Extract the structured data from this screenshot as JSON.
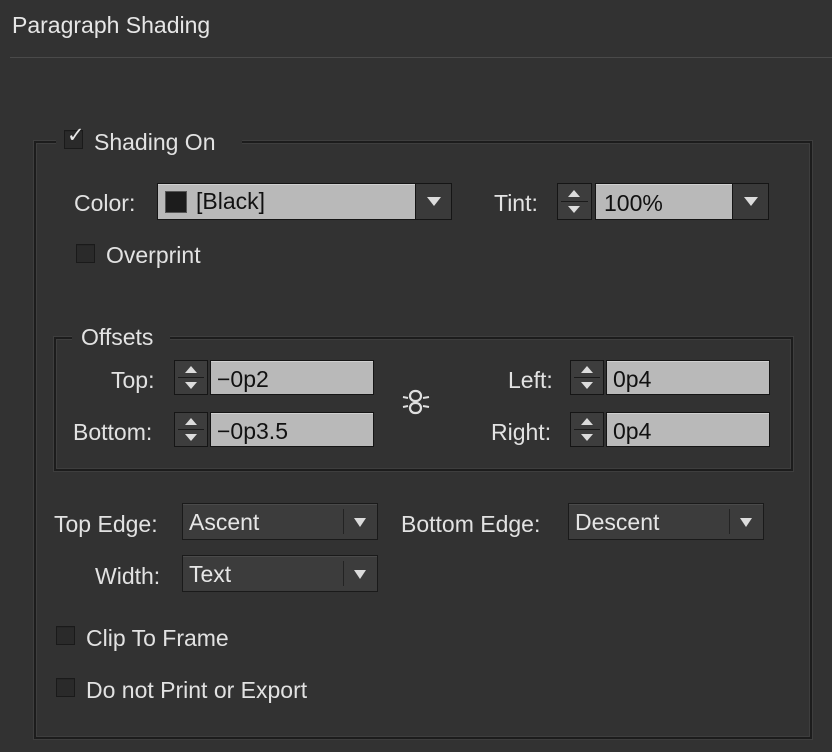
{
  "panel": {
    "title": "Paragraph Shading"
  },
  "shading": {
    "label": "Shading On",
    "checked": true,
    "color_label": "Color:",
    "color_value": "[Black]",
    "swatch_color": "#1c1c1c",
    "tint_label": "Tint:",
    "tint_value": "100%",
    "overprint_label": "Overprint",
    "overprint_checked": false
  },
  "offsets": {
    "legend": "Offsets",
    "top_label": "Top:",
    "top_value": "−0p2",
    "bottom_label": "Bottom:",
    "bottom_value": "−0p3.5",
    "left_label": "Left:",
    "left_value": "0p4",
    "right_label": "Right:",
    "right_value": "0p4",
    "link_icon": "chain-link-icon"
  },
  "edges": {
    "top_edge_label": "Top Edge:",
    "top_edge_value": "Ascent",
    "bottom_edge_label": "Bottom Edge:",
    "bottom_edge_value": "Descent",
    "width_label": "Width:",
    "width_value": "Text"
  },
  "options": {
    "clip_label": "Clip To Frame",
    "clip_checked": false,
    "noprint_label": "Do not Print or Export",
    "noprint_checked": false
  }
}
